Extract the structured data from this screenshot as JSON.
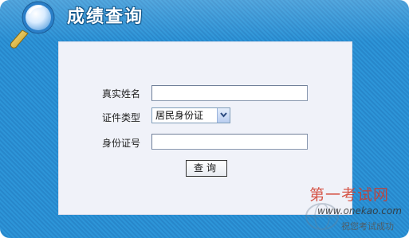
{
  "header": {
    "title": "成绩查询",
    "logo_icon": "magnifier-icon"
  },
  "form": {
    "name_label": "真实姓名",
    "name_value": "",
    "idtype_label": "证件类型",
    "idtype_selected": "居民身份证",
    "idnumber_label": "身份证号",
    "idnumber_value": "",
    "submit_label": "查询"
  },
  "watermark": {
    "brand": "第一考试网",
    "url": "www.onekao.com",
    "slogan": "祝您考试成功"
  },
  "colors": {
    "frame_blue": "#2d95d8",
    "panel_bg": "#f0f2f9",
    "watermark_red": "#d13a2a"
  }
}
